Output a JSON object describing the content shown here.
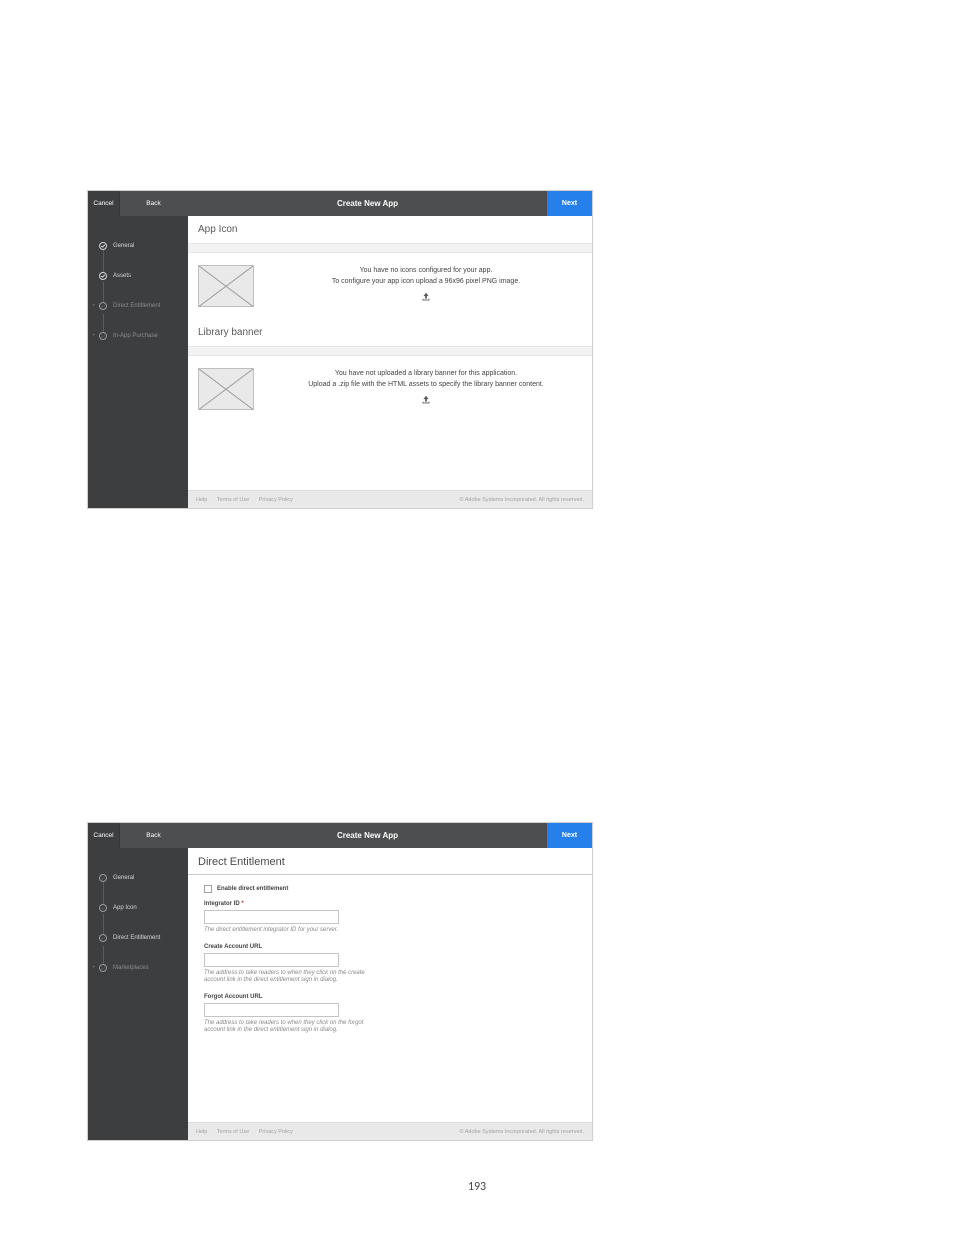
{
  "page_number": "193",
  "topbar": {
    "cancel": "Cancel",
    "back": "Back",
    "title": "Create New App",
    "next": "Next"
  },
  "shot1": {
    "sidebar": {
      "s1": "General",
      "s2": "Assets",
      "s3": "Direct Entitlement",
      "s4": "In-App Purchase"
    },
    "section1_title": "App Icon",
    "section1_msg1": "You have no icons configured for your app.",
    "section1_msg2": "To configure your app icon upload a 96x96 pixel PNG image.",
    "section2_title": "Library banner",
    "section2_msg1": "You have not uploaded a library banner for this application.",
    "section2_msg2": "Upload a .zip file with the HTML assets to specify the library banner content."
  },
  "shot2": {
    "sidebar": {
      "s1": "General",
      "s2": "App Icon",
      "s3": "Direct Entitlement",
      "s4": "Marketplaces"
    },
    "heading": "Direct Entitlement",
    "checkbox_label": "Enable direct entitlement",
    "f1_label": "Integrator ID",
    "f1_req": "*",
    "f1_desc": "The direct entitlement integrator ID for your server.",
    "f2_label": "Create Account URL",
    "f2_desc": "The address to take readers to when they click on the create account link in the direct entitlement sign in dialog.",
    "f3_label": "Forgot Account URL",
    "f3_desc": "The address to take readers to when they click on the forgot account link in the direct entitlement sign in dialog."
  },
  "footer": {
    "help": "Help",
    "terms": "Terms of Use",
    "privacy": "Privacy Policy",
    "copyright": "© Adobe Systems Incorporated. All rights reserved."
  }
}
